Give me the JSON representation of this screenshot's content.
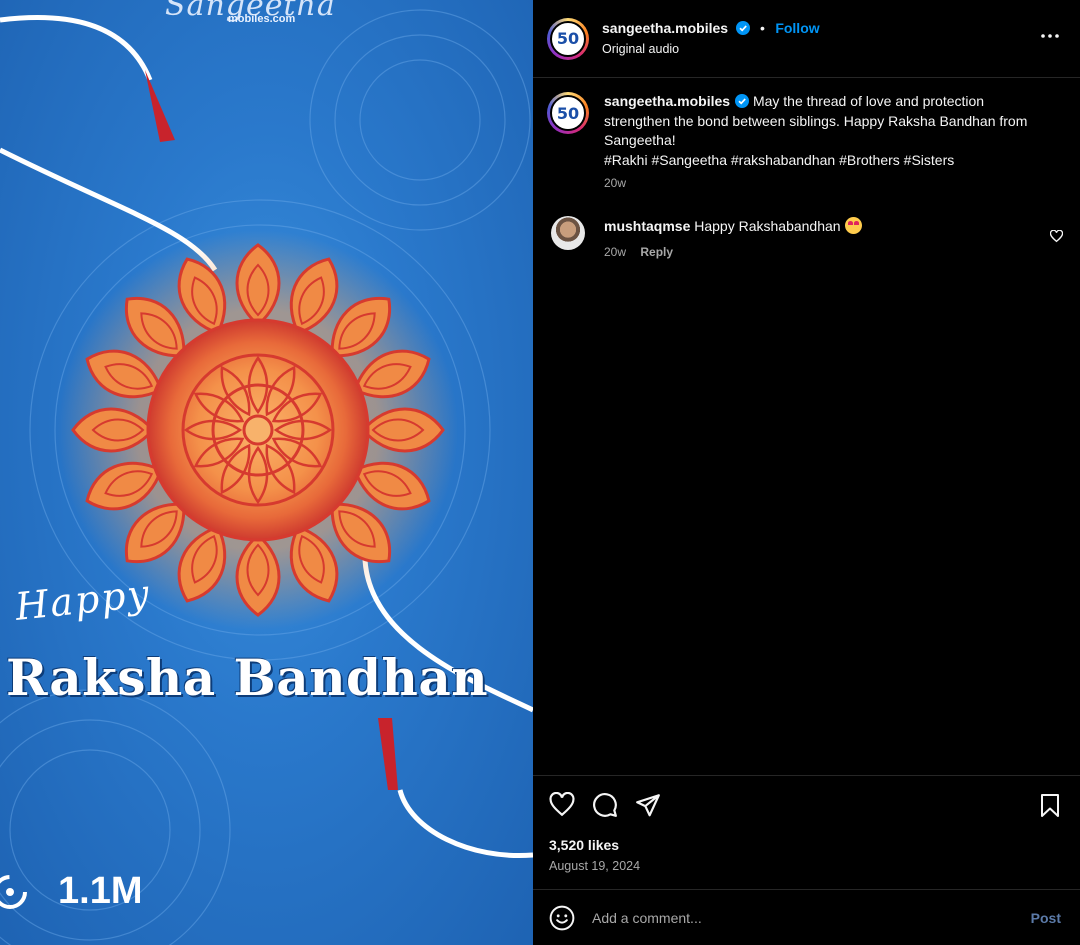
{
  "media": {
    "brand_logo": "Sangeetha",
    "brand_sub": "mobiles.com",
    "greeting_small": "Happy",
    "greeting_big": "Raksha Bandhan",
    "views": "1.1M",
    "bg_color": "#2a79cc",
    "mandala_color": "#f39a4d",
    "mandala_accent": "#d63a2f"
  },
  "header": {
    "avatar_text": "50",
    "username": "sangeetha.mobiles",
    "separator": "•",
    "follow_label": "Follow",
    "audio": "Original audio"
  },
  "caption": {
    "username": "sangeetha.mobiles",
    "text": "May the thread of love and protection strengthen the bond between siblings. Happy Raksha Bandhan from Sangeetha!",
    "hashtags": "#Rakhi #Sangeetha #rakshabandhan #Brothers #Sisters",
    "time": "20w"
  },
  "comments": [
    {
      "username": "mushtaqmse",
      "text": "Happy Rakshabandhan",
      "time": "20w",
      "reply_label": "Reply"
    }
  ],
  "stats": {
    "likes": "3,520 likes",
    "date": "August 19, 2024"
  },
  "composer": {
    "placeholder": "Add a comment...",
    "post_label": "Post"
  },
  "colors": {
    "accent": "#0095f6",
    "panel_bg": "#000000",
    "muted": "#a8a8a8"
  }
}
